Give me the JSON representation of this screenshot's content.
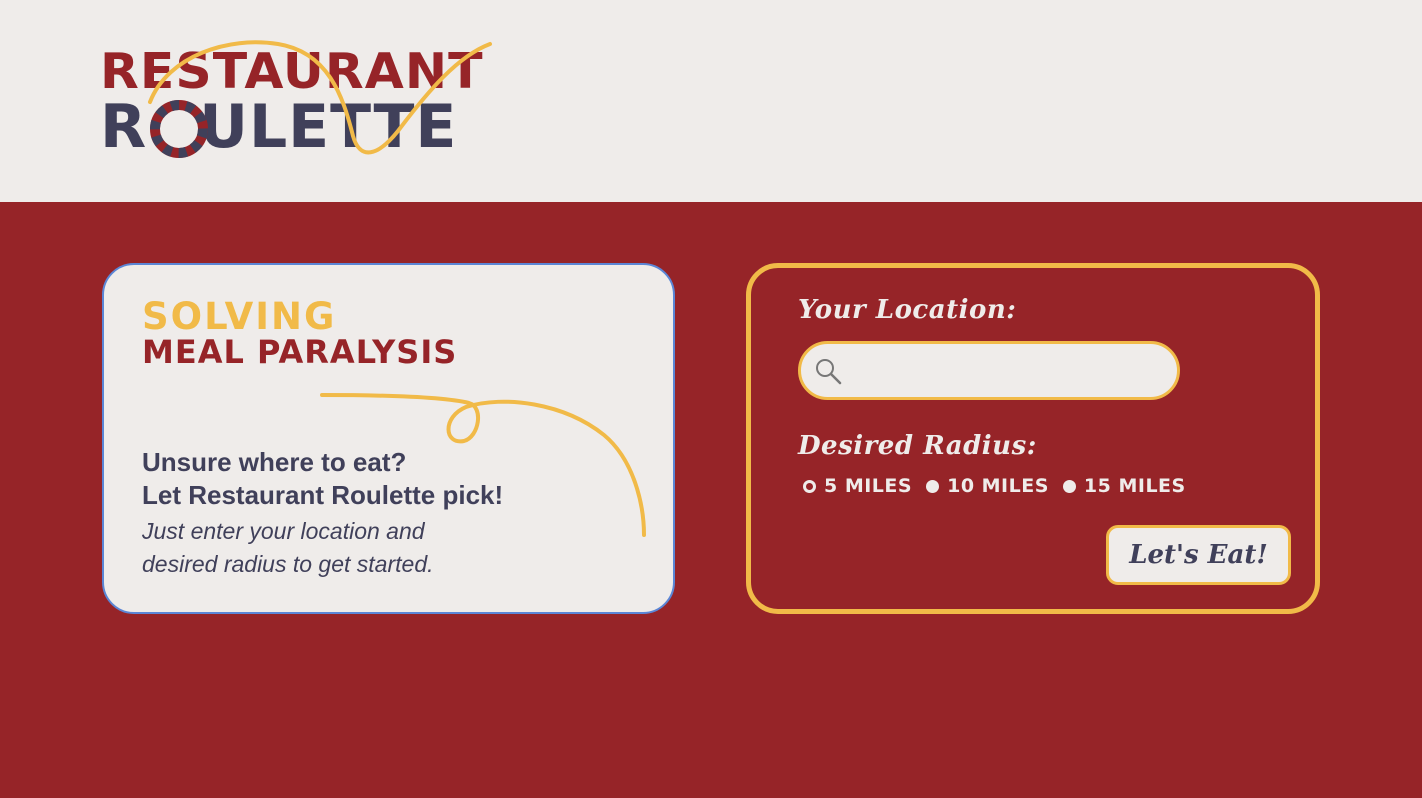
{
  "header": {
    "logo_line1": "RESTAURANT",
    "logo_line2_a": "R",
    "logo_line2_o": "O",
    "logo_line2_b": "ULETTE",
    "logo_alt": "Restaurant Roulette"
  },
  "intro_card": {
    "heading_top": "SOLVING",
    "heading_bottom": "MEAL PARALYSIS",
    "line1": "Unsure where to eat?",
    "line2": "Let Restaurant Roulette pick!",
    "sub1": "Just enter your location and",
    "sub2": "desired radius to get started."
  },
  "form": {
    "location_label": "Your Location:",
    "location_value": "",
    "location_placeholder": "",
    "radius_label": "Desired Radius:",
    "radius_options": [
      {
        "label": "5 MILES",
        "selected": true
      },
      {
        "label": "10 MILES",
        "selected": false
      },
      {
        "label": "15 MILES",
        "selected": false
      }
    ],
    "submit_label": "Let's Eat!"
  },
  "colors": {
    "brand_red": "#962428",
    "cream": "#efecea",
    "mustard": "#f1ba48",
    "slate": "#40405a",
    "focus_blue": "#5b86d6"
  }
}
